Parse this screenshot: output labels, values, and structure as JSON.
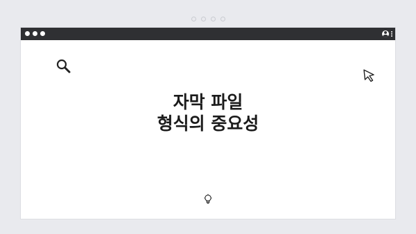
{
  "window": {
    "titlebar_controls": [
      "traffic-dots",
      "avatar-icon",
      "kebab-menu-icon"
    ]
  },
  "content": {
    "headline_line1": "자막 파일",
    "headline_line2": "형식의 중요성"
  },
  "icons": {
    "top_left": "search-icon",
    "top_right": "cursor-arrow-icon",
    "bottom": "lightbulb-icon"
  },
  "colors": {
    "background": "#e9eaee",
    "titlebar": "#2f3033",
    "window": "#ffffff",
    "text": "#1b1b1b"
  }
}
